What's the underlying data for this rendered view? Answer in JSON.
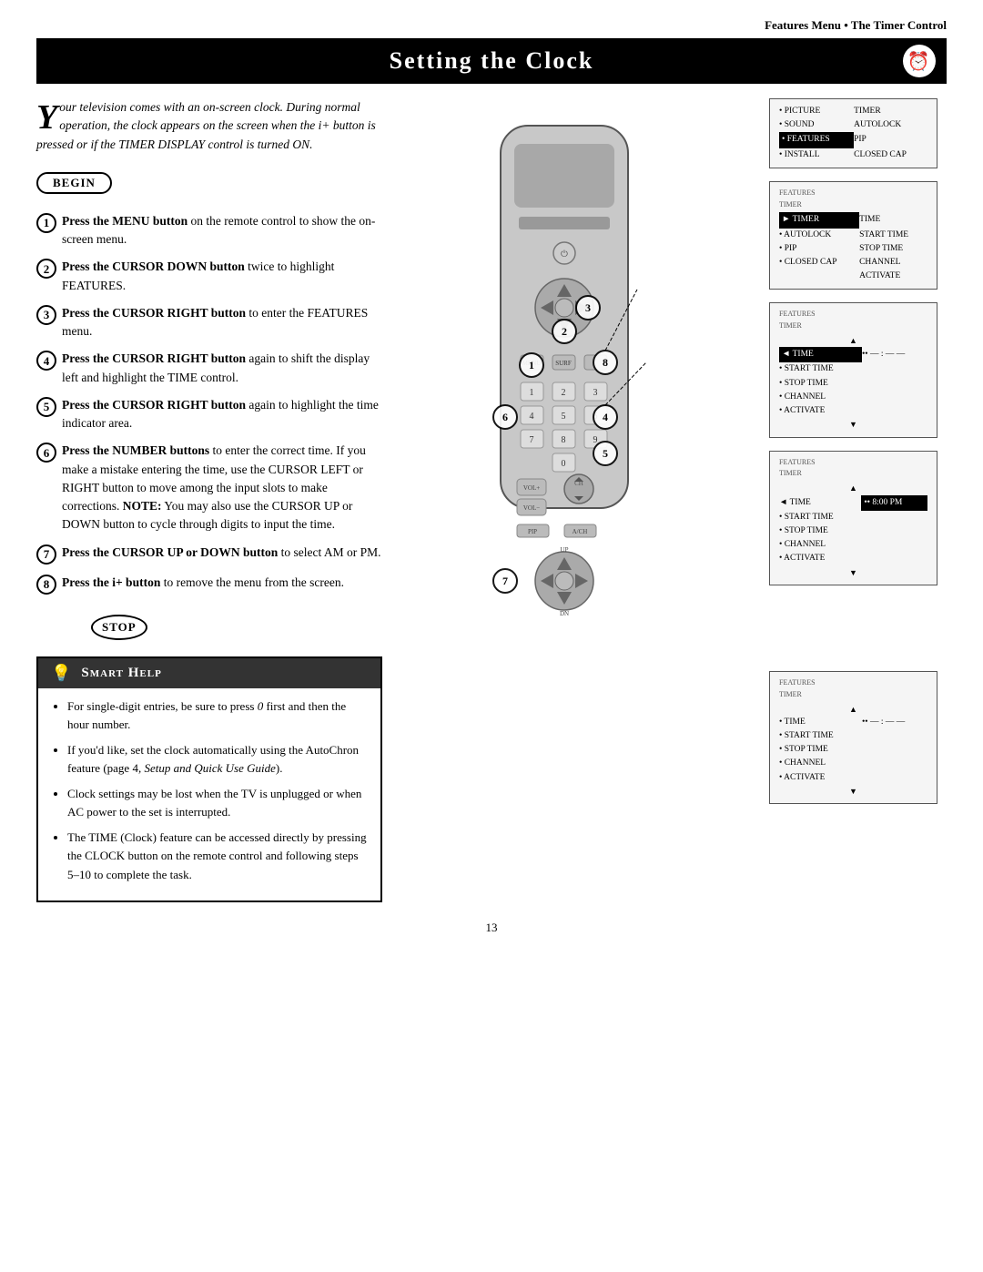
{
  "header": {
    "title": "Features Menu • The Timer Control"
  },
  "page_title": "Setting the Clock",
  "intro": {
    "drop_cap": "Y",
    "text": "our television comes with an on-screen clock. During normal operation, the clock appears on the screen when the i+ button is pressed or if the TIMER DISPLAY control is turned ON."
  },
  "begin_label": "BEGIN",
  "steps": [
    {
      "number": "1",
      "bold": "Press the MENU button",
      "rest": " on the remote control to show the on-screen menu."
    },
    {
      "number": "2",
      "bold": "Press the CURSOR DOWN button",
      "rest": " twice to highlight FEATURES."
    },
    {
      "number": "3",
      "bold": "Press the CURSOR RIGHT button",
      "rest": " to enter the FEATURES menu."
    },
    {
      "number": "4",
      "bold": "Press the CURSOR RIGHT button",
      "rest": " again to shift the display left and highlight the TIME control."
    },
    {
      "number": "5",
      "bold": "Press the CURSOR RIGHT button",
      "rest": " again to highlight the time indicator area."
    },
    {
      "number": "6",
      "bold": "Press the NUMBER buttons",
      "rest": " to enter the correct time. If you make a mistake entering the time, use the CURSOR LEFT or RIGHT button to move among the input slots to make corrections. NOTE: You may also use the CURSOR UP or DOWN button to cycle through digits to input the time."
    },
    {
      "number": "7",
      "bold": "Press the CURSOR UP or DOWN button",
      "rest": " to select AM or PM."
    },
    {
      "number": "8",
      "bold": "Press the i+ button",
      "rest": " to remove the menu from the screen."
    }
  ],
  "stop_label": "STOP",
  "smart_help": {
    "title": "Smart Help",
    "items": [
      "For single-digit entries, be sure to press 0 first and then the hour number.",
      "If you'd like, set the clock automatically using the AutoChron feature (page 4, Setup and Quick Use Guide).",
      "Clock settings may be lost when the TV is unplugged or when AC power to the set is interrupted.",
      "The TIME (Clock) feature can be accessed directly by pressing the CLOCK button on the remote control and following steps 5–10 to complete the task."
    ]
  },
  "menu_screens": [
    {
      "id": "screen1",
      "label": "Main Menu",
      "rows": [
        {
          "text": "• PICTURE",
          "bold": false,
          "col2": "TIMER"
        },
        {
          "text": "• SOUND",
          "bold": false,
          "col2": "AUTOLOCK"
        },
        {
          "text": "• FEATURES",
          "bold": true,
          "col2": "PIP"
        },
        {
          "text": "• INSTALL",
          "bold": false,
          "col2": "CLOSED CAP"
        }
      ]
    },
    {
      "id": "screen2",
      "label": "Features / Timer",
      "rows": [
        {
          "text": "FEATURES",
          "small": true
        },
        {
          "text": "TIMER",
          "small": true
        },
        {
          "text": "► TIMER",
          "highlight": true,
          "col2": "TIME"
        },
        {
          "text": "• AUTOLOCK",
          "col2": "START TIME"
        },
        {
          "text": "• PIP",
          "col2": "STOP TIME"
        },
        {
          "text": "• CLOSED CAP",
          "col2": "CHANNEL"
        },
        {
          "text": "",
          "col2": "ACTIVATE"
        }
      ]
    },
    {
      "id": "screen3",
      "label": "Timer / Time highlighted",
      "rows": [
        {
          "text": "FEATURES",
          "small": true
        },
        {
          "text": "TIMER",
          "small": true
        },
        {
          "text": "▲",
          "center": true
        },
        {
          "text": "◄ TIME",
          "highlight": true,
          "col2": "•• — : — —"
        },
        {
          "text": "• START TIME"
        },
        {
          "text": "• STOP TIME"
        },
        {
          "text": "• CHANNEL"
        },
        {
          "text": "• ACTIVATE"
        },
        {
          "text": "▼",
          "center": true
        }
      ]
    },
    {
      "id": "screen4",
      "label": "Timer / Time value",
      "rows": [
        {
          "text": "FEATURES",
          "small": true
        },
        {
          "text": "TIMER",
          "small": true
        },
        {
          "text": "▲",
          "center": true
        },
        {
          "text": "◄ TIME",
          "col2": "•• 8:00 PM",
          "highlight2": true
        },
        {
          "text": "• START TIME"
        },
        {
          "text": "• STOP TIME"
        },
        {
          "text": "• CHANNEL"
        },
        {
          "text": "• ACTIVATE"
        },
        {
          "text": "▼",
          "center": true
        }
      ]
    },
    {
      "id": "screen5",
      "label": "Timer / blank time",
      "rows": [
        {
          "text": "FEATURES",
          "small": true
        },
        {
          "text": "TIMER",
          "small": true
        },
        {
          "text": "▲",
          "center": true
        },
        {
          "text": "• TIME",
          "col2": "•• — : — —"
        },
        {
          "text": "• START TIME"
        },
        {
          "text": "• STOP TIME"
        },
        {
          "text": "• CHANNEL"
        },
        {
          "text": "• ACTIVATE"
        },
        {
          "text": "▼",
          "center": true
        }
      ]
    }
  ],
  "page_number": "13"
}
